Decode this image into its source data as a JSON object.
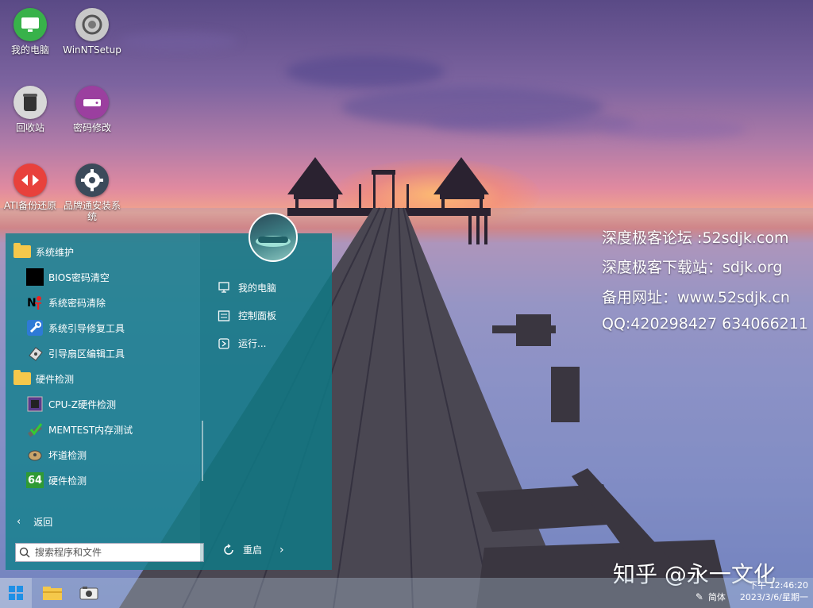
{
  "desktop": {
    "icons": [
      {
        "label": "我的电脑"
      },
      {
        "label": "WinNTSetup"
      },
      {
        "label": "回收站"
      },
      {
        "label": "密码修改"
      },
      {
        "label": "ATI备份还原"
      },
      {
        "label": "品牌通安装系统"
      }
    ]
  },
  "overlay_text": {
    "line1": "深度极客论坛 :52sdjk.com",
    "line2": "深度极客下载站：sdjk.org",
    "line3": "备用网址：www.52sdjk.cn",
    "line4": "QQ:420298427  634066211",
    "watermark": "知乎 @永一文化"
  },
  "start_menu": {
    "groups": [
      {
        "label": "系统维护"
      },
      {
        "label": "硬件检测"
      }
    ],
    "items": [
      {
        "label": "BIOS密码清空"
      },
      {
        "label": "系统密码清除"
      },
      {
        "label": "系统引导修复工具"
      },
      {
        "label": "引导扇区编辑工具"
      },
      {
        "label": "CPU-Z硬件检测"
      },
      {
        "label": "MEMTEST内存测试"
      },
      {
        "label": "坏道检测"
      },
      {
        "label": "硬件检测"
      }
    ],
    "back_label": "返回",
    "search_placeholder": "搜索程序和文件",
    "right_items": [
      {
        "label": "我的电脑"
      },
      {
        "label": "控制面板"
      },
      {
        "label": "运行..."
      }
    ],
    "restart_label": "重启",
    "cpuz_badge": "64"
  },
  "taskbar": {
    "lang": "简体",
    "time": "下午 12:46:20",
    "date": "2023/3/6/星期一"
  },
  "colors": {
    "menu_bg": "#14808c",
    "folder": "#f5c84b",
    "taskbar": "#b4c8dc"
  }
}
